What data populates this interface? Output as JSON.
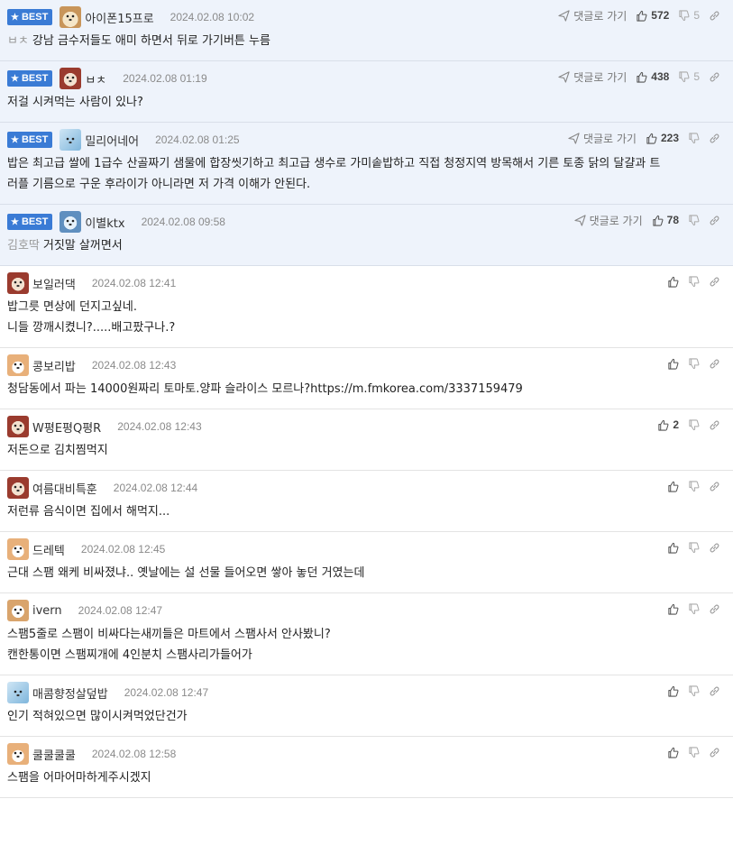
{
  "labels": {
    "best": "BEST",
    "reply": "댓글로 가기"
  },
  "comments": [
    {
      "best": true,
      "avatar": "dog-beige",
      "nick": "아이폰15프로",
      "date": "2024.02.08 10:02",
      "up": "572",
      "down": "5",
      "mention": "ㅂㅊ",
      "lines": [
        "강남 금수저들도 애미 하면서 뒤로 가기버튼 누름"
      ]
    },
    {
      "best": true,
      "avatar": "dog-red",
      "nick": "ㅂㅊ",
      "date": "2024.02.08 01:19",
      "up": "438",
      "down": "5",
      "mention": "",
      "lines": [
        "저걸 시켜먹는 사람이 있나?"
      ]
    },
    {
      "best": true,
      "avatar": "blue",
      "nick": "밀리어네어",
      "date": "2024.02.08 01:25",
      "up": "223",
      "down": "",
      "mention": "",
      "lines": [
        "밥은 최고급 쌀에 1급수 산골짜기 샘물에 합장씻기하고 최고급 생수로 가미솥밥하고 직접 청정지역 방목해서 기른 토종 닭의 달걀과 트",
        "러플 기름으로 구운 후라이가 아니라면 저 가격 이해가 안된다."
      ]
    },
    {
      "best": true,
      "avatar": "blueface",
      "nick": "이별ktx",
      "date": "2024.02.08 09:58",
      "up": "78",
      "down": "",
      "mention": "김호딱",
      "lines": [
        "거짓말 살꺼면서"
      ]
    },
    {
      "best": false,
      "avatar": "dog-red",
      "nick": "보일러댁",
      "date": "2024.02.08 12:41",
      "up": "",
      "down": "",
      "mention": "",
      "lines": [
        "밥그릇 면상에 던지고싶네.",
        "니들 깡깨시켰니?.....배고팠구나.?"
      ]
    },
    {
      "best": false,
      "avatar": "fox",
      "nick": "콩보리밥",
      "date": "2024.02.08 12:43",
      "up": "",
      "down": "",
      "mention": "",
      "lines": [
        "청담동에서 파는 14000원짜리 토마토.양파 슬라이스 모르나?https://m.fmkorea.com/3337159479"
      ]
    },
    {
      "best": false,
      "avatar": "dog-red",
      "nick": "W평E평Q평R",
      "date": "2024.02.08 12:43",
      "up": "2",
      "down": "",
      "mention": "",
      "lines": [
        "저돈으로 김치찜먹지"
      ]
    },
    {
      "best": false,
      "avatar": "dog-red",
      "nick": "여름대비특훈",
      "date": "2024.02.08 12:44",
      "up": "",
      "down": "",
      "mention": "",
      "lines": [
        "저런류 음식이면 집에서 해먹지..."
      ]
    },
    {
      "best": false,
      "avatar": "fox",
      "nick": "드레텍",
      "date": "2024.02.08 12:45",
      "up": "",
      "down": "",
      "mention": "",
      "lines": [
        "근대 스팸 왜케 비싸졌냐.. 옛날에는 설 선물 들어오면 쌓아 놓던 거였는데"
      ]
    },
    {
      "best": false,
      "avatar": "pup",
      "nick": "ivern",
      "date": "2024.02.08 12:47",
      "up": "",
      "down": "",
      "mention": "",
      "lines": [
        "스팸5줄로 스팸이 비싸다는새끼들은 마트에서 스팸사서 안사봤니?",
        "캔한통이면 스팸찌개에 4인분치 스팸사리가들어가"
      ]
    },
    {
      "best": false,
      "avatar": "blue",
      "nick": "매콤향정살덮밥",
      "date": "2024.02.08 12:47",
      "up": "",
      "down": "",
      "mention": "",
      "lines": [
        "인기 적혀있으면 많이시켜먹었단건가"
      ]
    },
    {
      "best": false,
      "avatar": "fox",
      "nick": "쿨쿨쿨쿨",
      "date": "2024.02.08 12:58",
      "up": "",
      "down": "",
      "mention": "",
      "lines": [
        "스팸을 어마어마하게주시겠지"
      ]
    }
  ]
}
